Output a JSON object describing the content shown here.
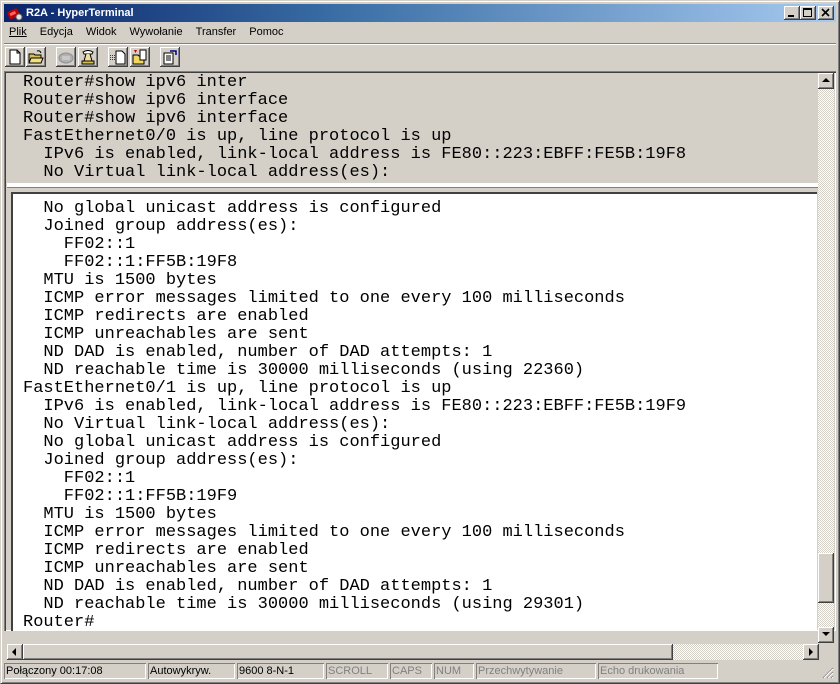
{
  "window": {
    "title": "R2A - HyperTerminal",
    "controls": {
      "minimize": "_",
      "maximize": "□",
      "close": "×"
    }
  },
  "menubar": {
    "items": [
      {
        "label": "Plik",
        "accel": "P"
      },
      {
        "label": "Edycja",
        "accel": "E"
      },
      {
        "label": "Widok",
        "accel": "W"
      },
      {
        "label": "Wywołanie",
        "accel": "a"
      },
      {
        "label": "Transfer",
        "accel": "T"
      },
      {
        "label": "Pomoc",
        "accel": "c"
      }
    ]
  },
  "toolbar": {
    "buttons": [
      {
        "icon": "new-document-icon"
      },
      {
        "icon": "open-folder-icon"
      },
      {
        "icon": "connect-phone-icon",
        "disabled": true
      },
      {
        "icon": "disconnect-phone-icon"
      },
      {
        "icon": "send-file-icon"
      },
      {
        "icon": "receive-file-icon"
      },
      {
        "icon": "properties-icon"
      }
    ]
  },
  "terminal": {
    "backscroll_lines": [
      "Router#show ipv6 inter",
      "Router#show ipv6 interface",
      "Router#show ipv6 interface",
      "FastEthernet0/0 is up, line protocol is up",
      "  IPv6 is enabled, link-local address is FE80::223:EBFF:FE5B:19F8",
      "  No Virtual link-local address(es):"
    ],
    "screen_lines": [
      "  No global unicast address is configured",
      "  Joined group address(es):",
      "    FF02::1",
      "    FF02::1:FF5B:19F8",
      "  MTU is 1500 bytes",
      "  ICMP error messages limited to one every 100 milliseconds",
      "  ICMP redirects are enabled",
      "  ICMP unreachables are sent",
      "  ND DAD is enabled, number of DAD attempts: 1",
      "  ND reachable time is 30000 milliseconds (using 22360)",
      "FastEthernet0/1 is up, line protocol is up",
      "  IPv6 is enabled, link-local address is FE80::223:EBFF:FE5B:19F9",
      "  No Virtual link-local address(es):",
      "  No global unicast address is configured",
      "  Joined group address(es):",
      "    FF02::1",
      "    FF02::1:FF5B:19F9",
      "  MTU is 1500 bytes",
      "  ICMP error messages limited to one every 100 milliseconds",
      "  ICMP redirects are enabled",
      "  ICMP unreachables are sent",
      "  ND DAD is enabled, number of DAD attempts: 1",
      "  ND reachable time is 30000 milliseconds (using 29301)",
      "Router#"
    ]
  },
  "scrollbars": {
    "vertical_position_fraction": 0.95,
    "horizontal_position_fraction": 0.0
  },
  "statusbar": {
    "connection": "Połączony 00:17:08",
    "detect": "Autowykryw.",
    "port_settings": "9600 8-N-1",
    "scroll": "SCROLL",
    "caps": "CAPS",
    "num": "NUM",
    "capture": "Przechwytywanie",
    "print_echo": "Echo drukowania"
  }
}
